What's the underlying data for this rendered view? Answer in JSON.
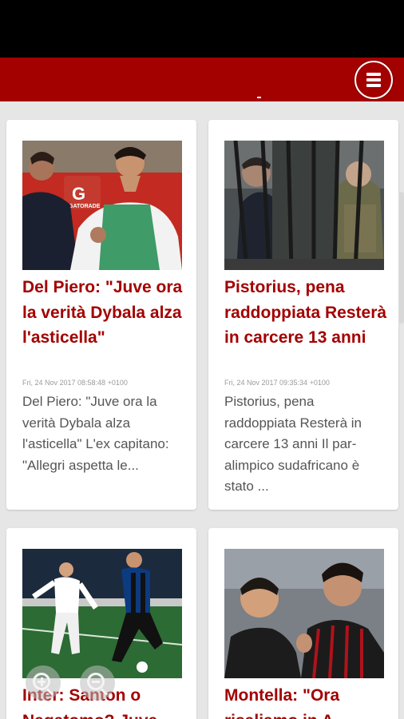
{
  "cards": [
    {
      "title": "Del Piero: \"Juve ora la verità Dybala alza l'asticella\"",
      "date": "Fri, 24 Nov 2017 08:58:48 +0100",
      "excerpt": "Del Piero: \"Juve ora la verità Dybala alza l'asticella\" L'ex capitano: \"Allegri aspetta le..."
    },
    {
      "title": "Pistorius, pena raddoppiata Resterà in carcere 13 anni",
      "date": "Fri, 24 Nov 2017 09:35:34 +0100",
      "excerpt": "Pistorius, pena raddoppiata Resterà in carcere 13 anni Il par-alimpico sudafricano è stato ..."
    },
    {
      "title": "Inter: Santon o Nagatomo? Juve",
      "date": "",
      "excerpt": ""
    },
    {
      "title": "Montella: \"Ora risaliamo in A",
      "date": "",
      "excerpt": ""
    }
  ],
  "photo_text": {
    "gatorade": "GATORADE"
  },
  "colors": {
    "brand_red": "#a30000",
    "status_bar": "#000000",
    "background": "#e6e6e6"
  },
  "icons": {
    "menu": "hamburger-icon",
    "zoom_in": "zoom-in-icon",
    "zoom_out": "zoom-out-icon"
  }
}
